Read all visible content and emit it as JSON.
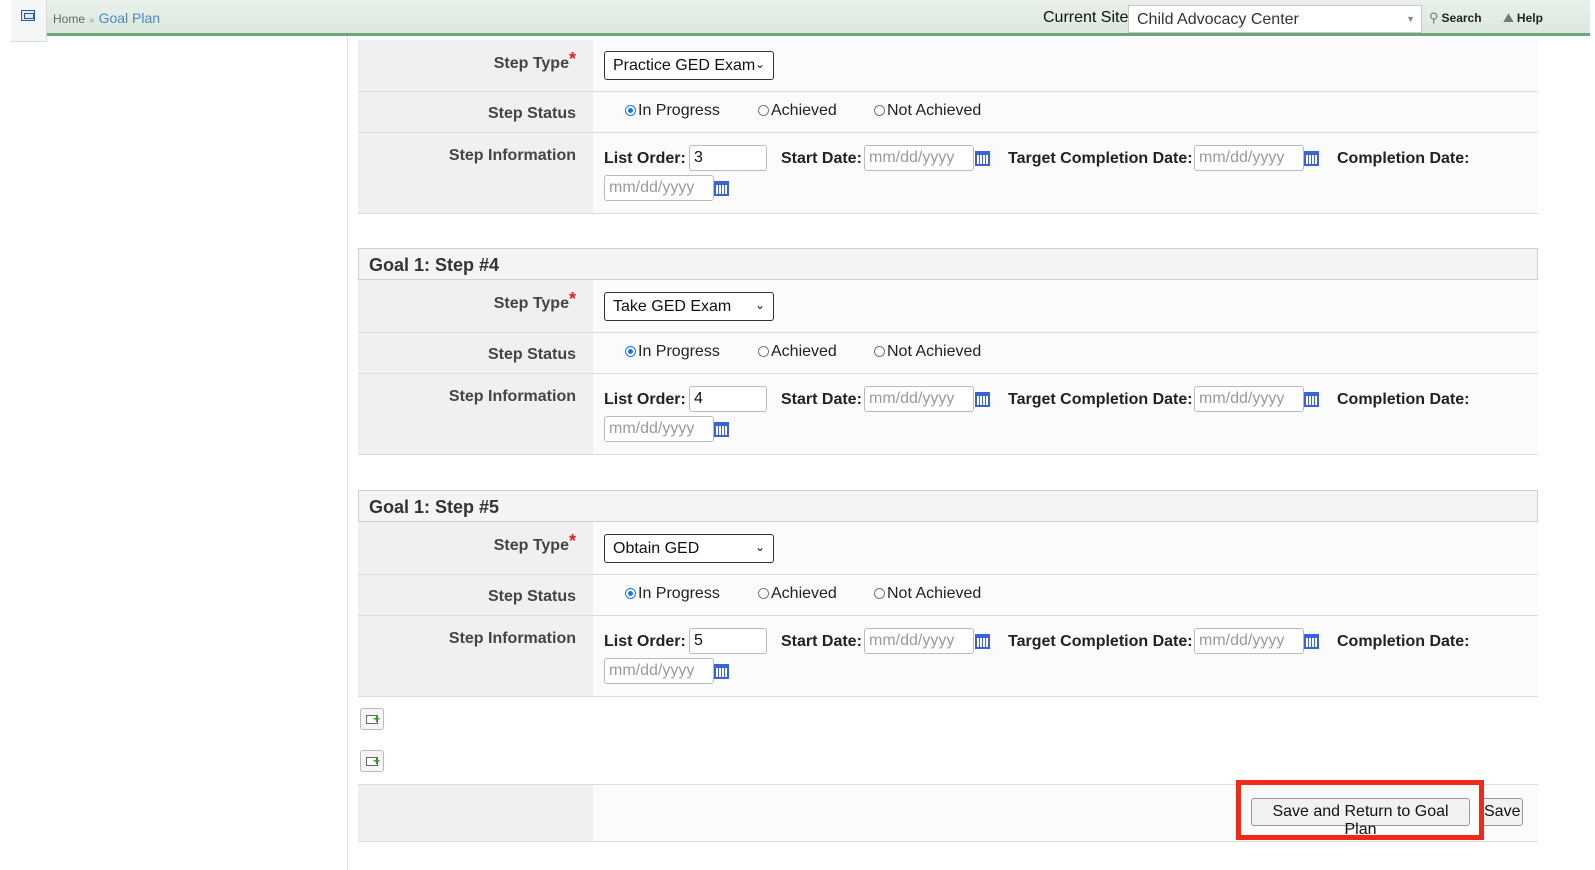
{
  "topbar": {
    "breadcrumb_home": "Home",
    "breadcrumb_sep": "»",
    "breadcrumb_current": "Goal Plan",
    "current_site_label": "Current Site",
    "current_site_value": "Child Advocacy Center",
    "search_label": "Search",
    "help_label": "Help"
  },
  "labels": {
    "step_type": "Step Type",
    "required_mark": "*",
    "step_status": "Step Status",
    "step_information": "Step Information",
    "list_order": "List Order:",
    "start_date": "Start Date:",
    "target_completion_date": "Target Completion Date:",
    "completion_date": "Completion Date:",
    "date_placeholder": "mm/dd/yyyy",
    "status_in_progress": "In Progress",
    "status_achieved": "Achieved",
    "status_not_achieved": "Not Achieved"
  },
  "steps": [
    {
      "title": "",
      "step_type": "Practice GED Exam",
      "status": "In Progress",
      "list_order": "3"
    },
    {
      "title": "Goal 1: Step #4",
      "step_type": "Take GED Exam",
      "status": "In Progress",
      "list_order": "4"
    },
    {
      "title": "Goal 1: Step #5",
      "step_type": "Obtain GED",
      "status": "In Progress",
      "list_order": "5"
    }
  ],
  "buttons": {
    "save_and_return": "Save and Return to Goal Plan",
    "save": "Save"
  },
  "colors": {
    "accent_green": "#6fa57a",
    "link_blue": "#4a8ac4",
    "required_red": "#e02020",
    "highlight_red": "#ee2a1b"
  }
}
